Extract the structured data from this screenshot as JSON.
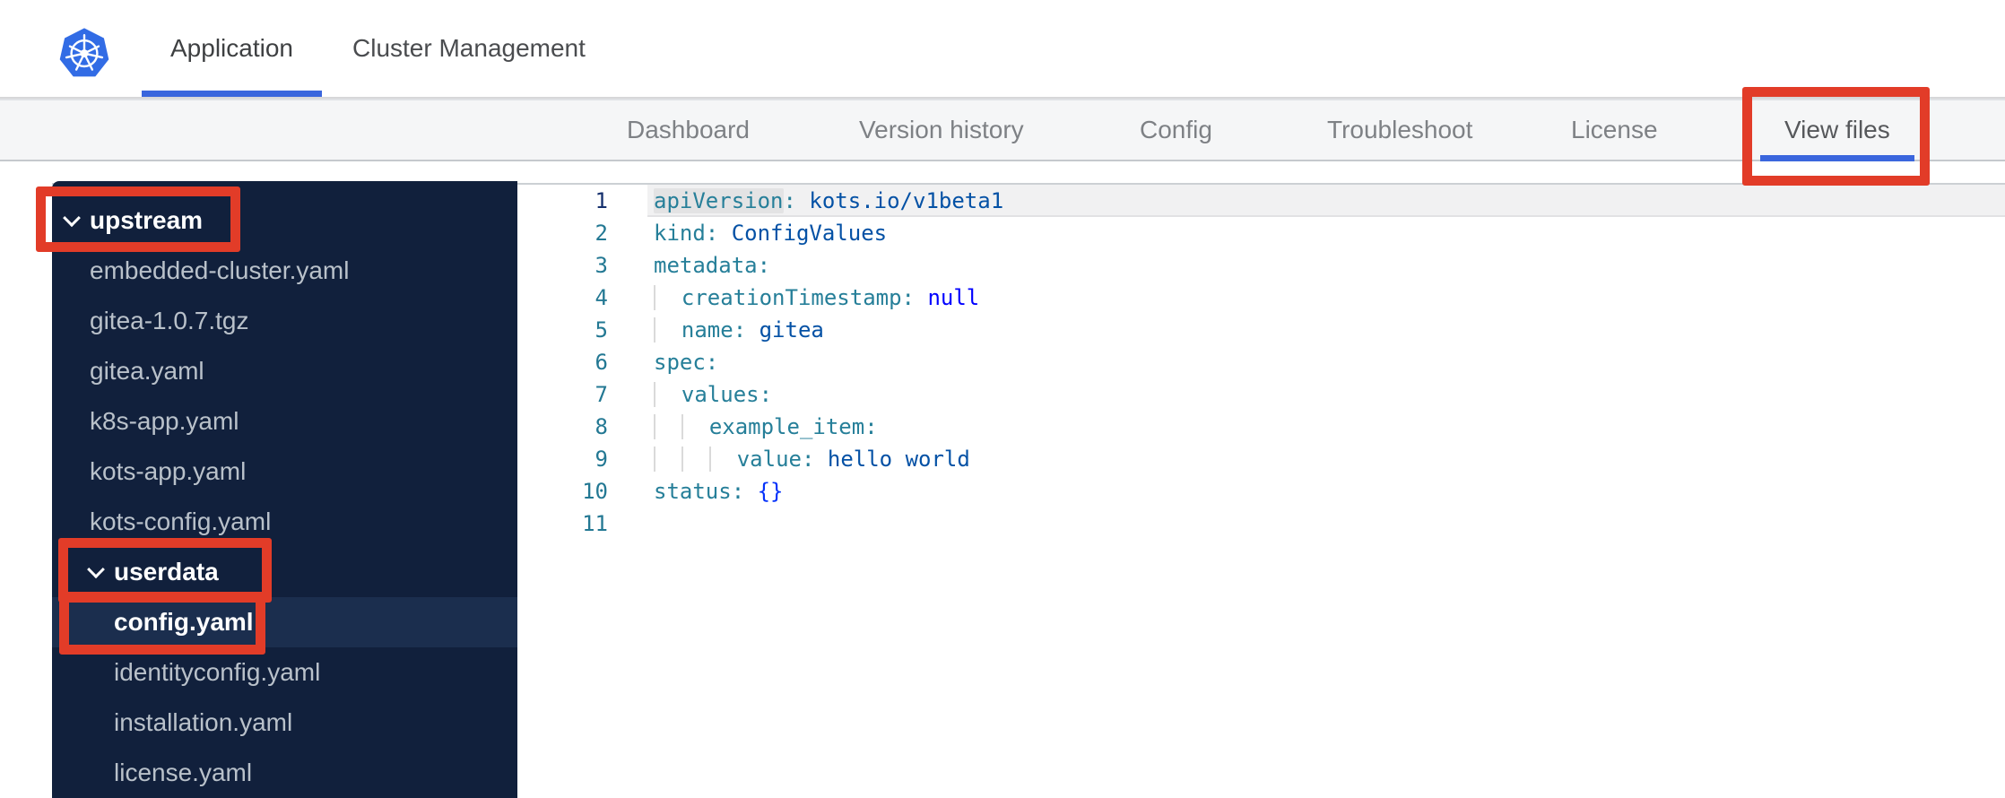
{
  "header": {
    "tabs": [
      {
        "label": "Application",
        "active": true
      },
      {
        "label": "Cluster Management",
        "active": false
      }
    ]
  },
  "subnav": {
    "items": [
      {
        "label": "Dashboard",
        "active": false
      },
      {
        "label": "Version history",
        "active": false
      },
      {
        "label": "Config",
        "active": false
      },
      {
        "label": "Troubleshoot",
        "active": false
      },
      {
        "label": "License",
        "active": false
      },
      {
        "label": "View files",
        "active": true
      }
    ]
  },
  "file_tree": {
    "items": [
      {
        "label": "upstream",
        "kind": "folder",
        "level": 0,
        "expanded": true,
        "annotated": true
      },
      {
        "label": "embedded-cluster.yaml",
        "kind": "file",
        "level": 1
      },
      {
        "label": "gitea-1.0.7.tgz",
        "kind": "file",
        "level": 1
      },
      {
        "label": "gitea.yaml",
        "kind": "file",
        "level": 1
      },
      {
        "label": "k8s-app.yaml",
        "kind": "file",
        "level": 1
      },
      {
        "label": "kots-app.yaml",
        "kind": "file",
        "level": 1
      },
      {
        "label": "kots-config.yaml",
        "kind": "file",
        "level": 1
      },
      {
        "label": "userdata",
        "kind": "folder",
        "level": 1,
        "expanded": true,
        "annotated": true
      },
      {
        "label": "config.yaml",
        "kind": "file",
        "level": 2,
        "selected": true,
        "annotated": true
      },
      {
        "label": "identityconfig.yaml",
        "kind": "file",
        "level": 2
      },
      {
        "label": "installation.yaml",
        "kind": "file",
        "level": 2
      },
      {
        "label": "license.yaml",
        "kind": "file",
        "level": 2
      }
    ]
  },
  "editor": {
    "language": "yaml",
    "lines": [
      {
        "num": "1",
        "indent": 0,
        "active": true,
        "segments": [
          {
            "text": "apiVersion",
            "cls": "key",
            "word_highlight": true
          },
          {
            "text": ":",
            "cls": "key"
          },
          {
            "text": " "
          },
          {
            "text": "kots.io/v1beta1",
            "cls": "str"
          }
        ]
      },
      {
        "num": "2",
        "indent": 0,
        "segments": [
          {
            "text": "kind",
            "cls": "key"
          },
          {
            "text": ":",
            "cls": "key"
          },
          {
            "text": " "
          },
          {
            "text": "ConfigValues",
            "cls": "str"
          }
        ]
      },
      {
        "num": "3",
        "indent": 0,
        "segments": [
          {
            "text": "metadata",
            "cls": "key"
          },
          {
            "text": ":",
            "cls": "key"
          }
        ]
      },
      {
        "num": "4",
        "indent": 1,
        "segments": [
          {
            "text": "creationTimestamp",
            "cls": "key"
          },
          {
            "text": ":",
            "cls": "key"
          },
          {
            "text": " "
          },
          {
            "text": "null",
            "cls": "kw"
          }
        ]
      },
      {
        "num": "5",
        "indent": 1,
        "segments": [
          {
            "text": "name",
            "cls": "key"
          },
          {
            "text": ":",
            "cls": "key"
          },
          {
            "text": " "
          },
          {
            "text": "gitea",
            "cls": "str"
          }
        ]
      },
      {
        "num": "6",
        "indent": 0,
        "segments": [
          {
            "text": "spec",
            "cls": "key"
          },
          {
            "text": ":",
            "cls": "key"
          }
        ]
      },
      {
        "num": "7",
        "indent": 1,
        "segments": [
          {
            "text": "values",
            "cls": "key"
          },
          {
            "text": ":",
            "cls": "key"
          }
        ]
      },
      {
        "num": "8",
        "indent": 2,
        "segments": [
          {
            "text": "example_item",
            "cls": "key"
          },
          {
            "text": ":",
            "cls": "key"
          }
        ]
      },
      {
        "num": "9",
        "indent": 3,
        "segments": [
          {
            "text": "value",
            "cls": "key"
          },
          {
            "text": ":",
            "cls": "key"
          },
          {
            "text": " "
          },
          {
            "text": "hello world",
            "cls": "str"
          }
        ]
      },
      {
        "num": "10",
        "indent": 0,
        "segments": [
          {
            "text": "status",
            "cls": "key"
          },
          {
            "text": ":",
            "cls": "key"
          },
          {
            "text": " "
          },
          {
            "text": "{}",
            "cls": "brk"
          }
        ]
      },
      {
        "num": "11",
        "indent": 0,
        "segments": []
      }
    ]
  },
  "annotations": {
    "color": "#e23c28",
    "highlighted": [
      "view-files-tab",
      "upstream-folder",
      "userdata-folder",
      "config-yaml-file"
    ]
  },
  "colors": {
    "brand_blue": "#326ce5",
    "tab_underline": "#3a66dd",
    "annotation_red": "#e23c28",
    "sidebar_bg": "#11203c",
    "sidebar_selected": "#1b2e4e",
    "code_key": "#267f99",
    "code_string": "#0451a5",
    "code_keyword": "#0000ff",
    "code_bracket": "#0431fa",
    "line_number": "#237893"
  }
}
